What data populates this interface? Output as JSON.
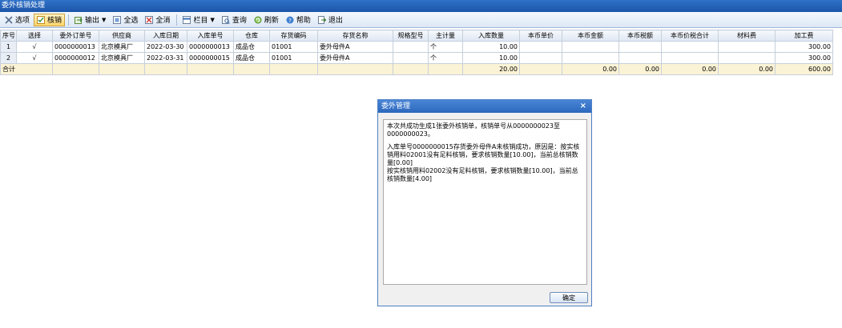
{
  "window": {
    "title": "委外核销处理"
  },
  "toolbar": {
    "options": "选项",
    "writeoff": "核销",
    "output": "输出",
    "select_all": "全选",
    "deselect_all": "全消",
    "columns": "栏目",
    "query": "查询",
    "refresh": "刷新",
    "help": "帮助",
    "exit": "退出"
  },
  "grid": {
    "headers": [
      "序号",
      "选择",
      "委外订单号",
      "供应商",
      "入库日期",
      "入库单号",
      "仓库",
      "存货编码",
      "存货名称",
      "规格型号",
      "主计量",
      "入库数量",
      "本币单价",
      "本币金额",
      "本币税额",
      "本币价税合计",
      "材料费",
      "加工费"
    ],
    "rows": [
      {
        "no": "1",
        "select": "√",
        "order_no": "0000000013",
        "supplier": "北京模具厂",
        "date": "2022-03-30",
        "receipt_no": "0000000013",
        "warehouse": "成品仓",
        "item_code": "01001",
        "item_name": "委外母件A",
        "spec": "",
        "unit": "个",
        "qty": "10.00",
        "price": "",
        "amount": "",
        "tax": "",
        "total": "",
        "material": "",
        "processing": "300.00"
      },
      {
        "no": "2",
        "select": "√",
        "order_no": "0000000012",
        "supplier": "北京模具厂",
        "date": "2022-03-31",
        "receipt_no": "0000000015",
        "warehouse": "成品仓",
        "item_code": "01001",
        "item_name": "委外母件A",
        "spec": "",
        "unit": "个",
        "qty": "10.00",
        "price": "",
        "amount": "",
        "tax": "",
        "total": "",
        "material": "",
        "processing": "300.00"
      }
    ],
    "total": {
      "label": "合计",
      "qty": "20.00",
      "amount": "0.00",
      "tax": "0.00",
      "total": "0.00",
      "material": "0.00",
      "processing": "600.00"
    }
  },
  "dialog": {
    "title": "委外管理",
    "message1": "本次共成功生成1张委外核销单，核销单号从0000000023至0000000023。",
    "message2": "入库单号0000000015存货委外母件A未核销成功，原因是：按实核销用料02001没有足料核销，要求核销数量[10.00]，当前总核销数量[0.00]\n按实核销用料02002没有足料核销，要求核销数量[10.00]，当前总核销数量[4.00]",
    "ok": "确定"
  }
}
